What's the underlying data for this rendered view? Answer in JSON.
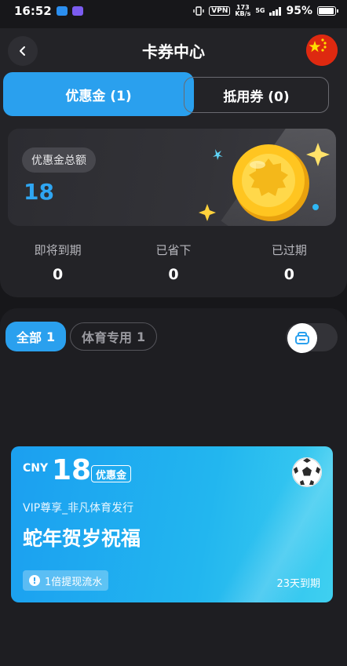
{
  "status_bar": {
    "time": "16:52",
    "vpn": "VPN",
    "speed_value": "173",
    "speed_unit": "KB/s",
    "network": "5G",
    "battery_percent": "95%",
    "battery_level": 0.95
  },
  "header": {
    "title": "卡券中心",
    "back_icon": "chevron-left-icon",
    "region_icon": "china-flag-icon"
  },
  "tabs": [
    {
      "label": "优惠金 (1)",
      "active": true
    },
    {
      "label": "抵用券 (0)",
      "active": false
    }
  ],
  "summary": {
    "badge": "优惠金总额",
    "amount": "18"
  },
  "stats": [
    {
      "label": "即将到期",
      "value": "0"
    },
    {
      "label": "已省下",
      "value": "0"
    },
    {
      "label": "已过期",
      "value": "0"
    }
  ],
  "filters": {
    "all_label": "全部",
    "all_count": "1",
    "sport_label": "体育专用",
    "sport_count": "1"
  },
  "coupon": {
    "currency": "CNY",
    "amount": "18",
    "type": "优惠金",
    "issuer": "VIP尊享_非凡体育发行",
    "name": "蛇年贺岁祝福",
    "turnover": "1倍提现流水",
    "expiry": "23天到期",
    "icon": "soccer-ball-icon"
  },
  "colors": {
    "accent": "#2aa0ee",
    "background": "#17171a",
    "panel": "#232327"
  }
}
